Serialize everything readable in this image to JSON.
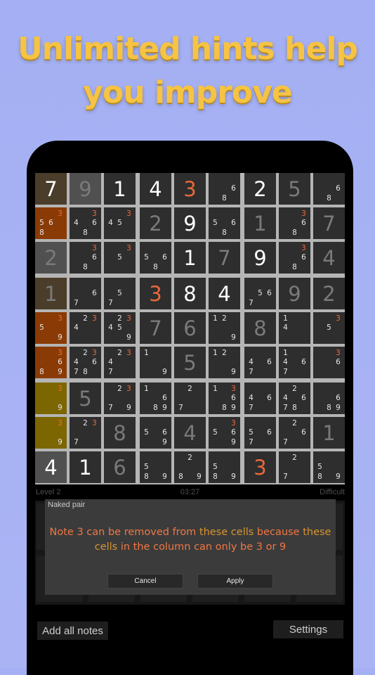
{
  "headline": {
    "line1": "Unlimited hints help",
    "line2": "you improve"
  },
  "board": {
    "rows": [
      [
        {
          "v": "7",
          "t": "given",
          "bg": "orange-big"
        },
        {
          "v": "9",
          "t": "user",
          "bg": "lite"
        },
        {
          "v": "1",
          "t": "given"
        },
        {
          "v": "4",
          "t": "given"
        },
        {
          "v": "3",
          "t": "hl"
        },
        {
          "n": [
            "",
            "",
            "",
            "",
            "",
            "6",
            "",
            "8",
            ""
          ]
        },
        {
          "v": "2",
          "t": "given"
        },
        {
          "v": "5",
          "t": "user"
        },
        {
          "n": [
            "",
            "",
            "",
            "",
            "",
            "6",
            "",
            "8",
            ""
          ]
        }
      ],
      [
        {
          "bg": "orange",
          "n": [
            "",
            "",
            "3",
            "5",
            "6",
            "",
            "8",
            "",
            ""
          ],
          "r": [
            2
          ]
        },
        {
          "n": [
            "",
            "",
            "3",
            "4",
            "",
            "6",
            "",
            "8",
            ""
          ],
          "r": [
            2
          ]
        },
        {
          "n": [
            "",
            "",
            "3",
            "4",
            "5",
            "",
            "",
            "",
            ""
          ],
          "r": [
            2
          ]
        },
        {
          "v": "2",
          "t": "user"
        },
        {
          "v": "9",
          "t": "given"
        },
        {
          "n": [
            "",
            "",
            "",
            "5",
            "",
            "6",
            "",
            "8",
            ""
          ]
        },
        {
          "v": "1",
          "t": "user"
        },
        {
          "n": [
            "",
            "",
            "3",
            "",
            "",
            "6",
            "",
            "8",
            ""
          ],
          "r": [
            2
          ]
        },
        {
          "v": "7",
          "t": "user"
        }
      ],
      [
        {
          "v": "2",
          "t": "user",
          "bg": "lite"
        },
        {
          "n": [
            "",
            "",
            "3",
            "",
            "",
            "6",
            "",
            "8",
            ""
          ],
          "r": [
            2
          ]
        },
        {
          "n": [
            "",
            "",
            "3",
            "",
            "5",
            "",
            "",
            "",
            ""
          ],
          "r": [
            2
          ]
        },
        {
          "n": [
            "",
            "",
            "",
            "5",
            "",
            "6",
            "",
            "8",
            ""
          ]
        },
        {
          "v": "1",
          "t": "given"
        },
        {
          "v": "7",
          "t": "user"
        },
        {
          "v": "9",
          "t": "given"
        },
        {
          "n": [
            "",
            "",
            "3",
            "",
            "",
            "6",
            "",
            "8",
            ""
          ],
          "r": [
            2
          ]
        },
        {
          "v": "4",
          "t": "user"
        }
      ],
      [
        {
          "v": "1",
          "t": "user",
          "bg": "orange-big"
        },
        {
          "n": [
            "",
            "",
            "",
            "",
            "",
            "6",
            "7",
            "",
            ""
          ]
        },
        {
          "n": [
            "",
            "",
            "",
            "",
            "5",
            "",
            "7",
            "",
            ""
          ]
        },
        {
          "v": "3",
          "t": "hl"
        },
        {
          "v": "8",
          "t": "given"
        },
        {
          "v": "4",
          "t": "given"
        },
        {
          "n": [
            "",
            "",
            "",
            "",
            "5",
            "6",
            "7",
            "",
            ""
          ]
        },
        {
          "v": "9",
          "t": "user"
        },
        {
          "v": "2",
          "t": "user"
        }
      ],
      [
        {
          "bg": "orange",
          "n": [
            "",
            "",
            "3",
            "5",
            "",
            "",
            "",
            "",
            "9"
          ],
          "r": [
            2
          ]
        },
        {
          "n": [
            "",
            "2",
            "3",
            "4",
            "",
            "",
            "",
            "",
            ""
          ],
          "r": [
            2
          ]
        },
        {
          "n": [
            "",
            "2",
            "3",
            "4",
            "5",
            "",
            "",
            "",
            "9"
          ],
          "r": [
            2
          ]
        },
        {
          "v": "7",
          "t": "user"
        },
        {
          "v": "6",
          "t": "user"
        },
        {
          "n": [
            "1",
            "2",
            "",
            "",
            "",
            "",
            "",
            "",
            "9"
          ]
        },
        {
          "v": "8",
          "t": "user"
        },
        {
          "n": [
            "1",
            "",
            "",
            "4",
            "",
            "",
            "",
            "",
            ""
          ]
        },
        {
          "n": [
            "",
            "",
            "3",
            "",
            "5",
            "",
            "",
            "",
            ""
          ],
          "r": [
            2
          ]
        }
      ],
      [
        {
          "bg": "orange",
          "n": [
            "",
            "",
            "3",
            "",
            "",
            "6",
            "8",
            "",
            "9"
          ],
          "r": [
            2
          ]
        },
        {
          "n": [
            "",
            "2",
            "3",
            "4",
            "",
            "6",
            "7",
            "8",
            ""
          ],
          "r": [
            2
          ]
        },
        {
          "n": [
            "",
            "2",
            "3",
            "4",
            "",
            "",
            "7",
            "",
            ""
          ],
          "r": [
            2
          ]
        },
        {
          "n": [
            "1",
            "",
            "",
            "",
            "",
            "",
            "",
            "",
            "9"
          ]
        },
        {
          "v": "5",
          "t": "user"
        },
        {
          "n": [
            "1",
            "2",
            "",
            "",
            "",
            "",
            "",
            "",
            "9"
          ]
        },
        {
          "n": [
            "",
            "",
            "",
            "4",
            "",
            "6",
            "7",
            "",
            ""
          ]
        },
        {
          "n": [
            "1",
            "",
            "",
            "4",
            "",
            "6",
            "7",
            "",
            ""
          ]
        },
        {
          "n": [
            "",
            "",
            "3",
            "",
            "",
            "6",
            "",
            "",
            ""
          ],
          "r": [
            2
          ]
        }
      ],
      [
        {
          "bg": "olive",
          "n": [
            "",
            "",
            "3",
            "",
            "",
            "",
            "",
            "",
            "9"
          ],
          "r": [
            2
          ]
        },
        {
          "v": "5",
          "t": "user"
        },
        {
          "n": [
            "",
            "2",
            "3",
            "",
            "",
            "",
            "7",
            "",
            "9"
          ],
          "r": [
            2
          ]
        },
        {
          "n": [
            "1",
            "",
            "",
            "",
            "",
            "6",
            "",
            "8",
            "9"
          ]
        },
        {
          "n": [
            "",
            "2",
            "",
            "",
            "",
            "",
            "7",
            "",
            ""
          ]
        },
        {
          "n": [
            "1",
            "",
            "3",
            "",
            "",
            "6",
            "",
            "8",
            "9"
          ],
          "r": [
            2
          ]
        },
        {
          "n": [
            "",
            "",
            "",
            "4",
            "",
            "6",
            "7",
            "",
            ""
          ]
        },
        {
          "n": [
            "",
            "2",
            "",
            "4",
            "",
            "6",
            "7",
            "8",
            ""
          ]
        },
        {
          "n": [
            "",
            "",
            "",
            "",
            "",
            "6",
            "",
            "8",
            "9"
          ]
        }
      ],
      [
        {
          "bg": "olive",
          "n": [
            "",
            "",
            "3",
            "",
            "",
            "",
            "",
            "",
            "9"
          ],
          "r": [
            2
          ]
        },
        {
          "n": [
            "",
            "2",
            "3",
            "",
            "",
            "",
            "7",
            "",
            ""
          ],
          "r": [
            2
          ]
        },
        {
          "v": "8",
          "t": "user"
        },
        {
          "n": [
            "",
            "",
            "",
            "5",
            "",
            "6",
            "",
            "",
            "9"
          ]
        },
        {
          "v": "4",
          "t": "user"
        },
        {
          "n": [
            "",
            "",
            "3",
            "5",
            "",
            "6",
            "",
            "",
            "9"
          ],
          "r": [
            2
          ]
        },
        {
          "n": [
            "",
            "",
            "",
            "5",
            "",
            "6",
            "7",
            "",
            ""
          ]
        },
        {
          "n": [
            "",
            "2",
            "",
            "",
            "",
            "6",
            "7",
            "",
            ""
          ]
        },
        {
          "v": "1",
          "t": "user"
        }
      ],
      [
        {
          "v": "4",
          "t": "given",
          "bg": "lite"
        },
        {
          "v": "1",
          "t": "given"
        },
        {
          "v": "6",
          "t": "user"
        },
        {
          "n": [
            "",
            "",
            "",
            "5",
            "",
            "",
            "8",
            "",
            "9"
          ]
        },
        {
          "n": [
            "",
            "2",
            "",
            "",
            "",
            "",
            "8",
            "",
            "9"
          ]
        },
        {
          "n": [
            "",
            "",
            "",
            "5",
            "",
            "",
            "8",
            "",
            "9"
          ]
        },
        {
          "v": "3",
          "t": "hl"
        },
        {
          "n": [
            "",
            "2",
            "",
            "",
            "",
            "",
            "7",
            "",
            ""
          ]
        },
        {
          "n": [
            "",
            "",
            "",
            "5",
            "",
            "",
            "8",
            "",
            "9"
          ]
        }
      ]
    ]
  },
  "info": {
    "level": "Level 2",
    "time": "03:27",
    "difficulty": "Difficult"
  },
  "dialog": {
    "title": "Naked pair",
    "msg_part1": "Note 3 can be removed from ",
    "msg_part2": "these cells",
    "msg_part3": " because ",
    "msg_part4": "these cells",
    "msg_part5": " in the column can only be 3 or 9",
    "cancel": "Cancel",
    "apply": "Apply"
  },
  "bottom": {
    "add_notes": "Add all notes",
    "settings": "Settings"
  },
  "colors": {
    "accent": "#f6c343",
    "highlight": "#e8683a",
    "note_red": "#ee6a3a"
  }
}
